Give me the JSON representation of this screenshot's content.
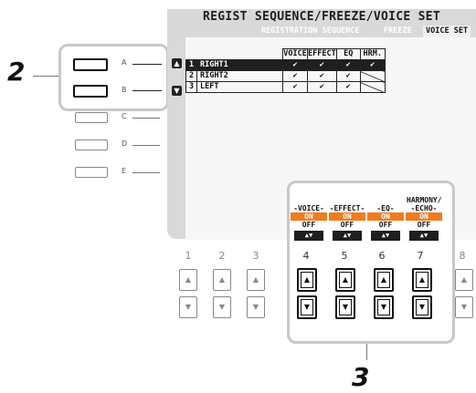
{
  "screen": {
    "title": "REGIST SEQUENCE/FREEZE/VOICE SET",
    "tabs": [
      "REGISTRATION SEQUENCE",
      "FREEZE",
      "VOICE SET"
    ],
    "active_tab": "VOICE SET",
    "headers": [
      "VOICE",
      "EFFECT",
      "EQ",
      "HRM."
    ],
    "rows": [
      {
        "num": "1",
        "part": "RIGHT1",
        "voice": "✔",
        "effect": "✔",
        "eq": "✔",
        "hrm": "✔"
      },
      {
        "num": "2",
        "part": "RIGHT2",
        "voice": "✔",
        "effect": "✔",
        "eq": "✔",
        "hrm": ""
      },
      {
        "num": "3",
        "part": "LEFT",
        "voice": "✔",
        "effect": "✔",
        "eq": "✔",
        "hrm": ""
      }
    ],
    "bottom_controls": [
      {
        "label": "VOICE",
        "on": "ON",
        "off": "OFF",
        "arrows": "▲▼"
      },
      {
        "label": "EFFECT",
        "on": "ON",
        "off": "OFF",
        "arrows": "▲▼"
      },
      {
        "label": "EQ",
        "on": "ON",
        "off": "OFF",
        "arrows": "▲▼"
      },
      {
        "label": "HARMONY/\nECHO",
        "on": "ON",
        "off": "OFF",
        "arrows": "▲▼"
      }
    ],
    "harmony_label_top": "HARMONY/",
    "harmony_label_bottom": "ECHO"
  },
  "left_buttons": [
    "A",
    "B",
    "C",
    "D",
    "E"
  ],
  "knob_numbers": [
    "1",
    "2",
    "3",
    "4",
    "5",
    "6",
    "7",
    "8"
  ],
  "callouts": {
    "left": "2",
    "bottom": "3"
  },
  "colors": {
    "accent": "#f07b20",
    "lcd_bg": "#d9d9d9",
    "selected_row": "#1f1f1f"
  }
}
